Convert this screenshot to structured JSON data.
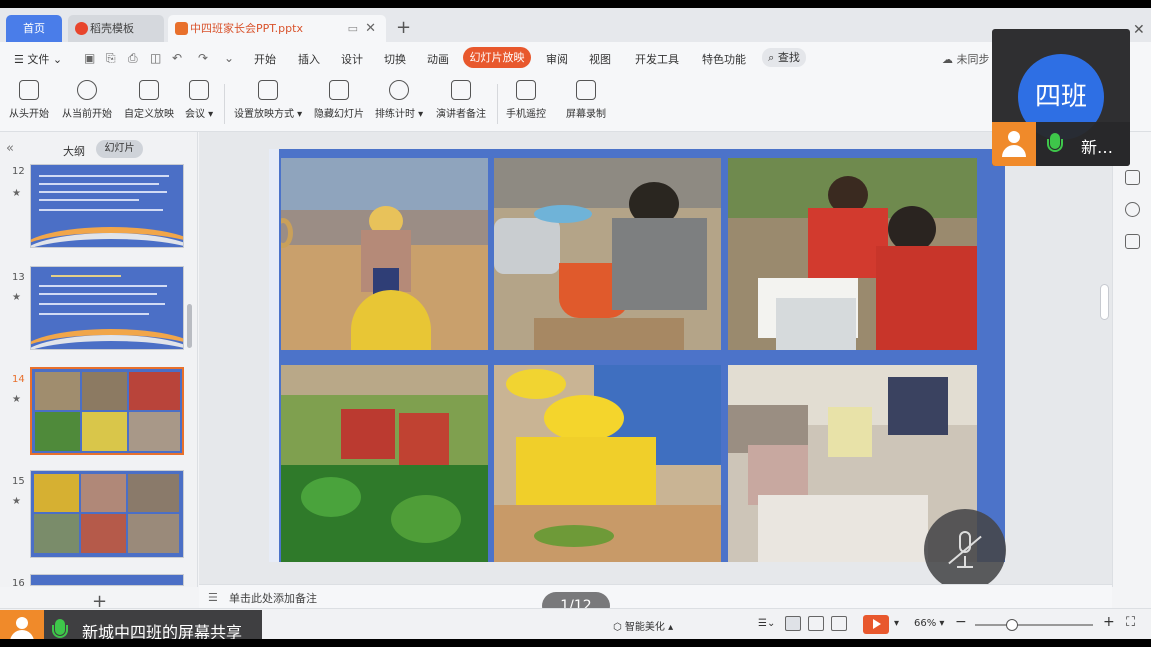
{
  "tabs": {
    "home": "首页",
    "template": "稻壳模板",
    "file": "中四班家长会PPT.pptx"
  },
  "menu": {
    "file": "文件",
    "items": [
      "开始",
      "插入",
      "设计",
      "切换",
      "动画",
      "幻灯片放映",
      "审阅",
      "视图",
      "开发工具",
      "特色功能"
    ],
    "active": "幻灯片放映",
    "search": "查找",
    "sync": "未同步"
  },
  "ribbon": {
    "buttons": [
      "从头开始",
      "从当前开始",
      "自定义放映",
      "会议",
      "设置放映方式",
      "隐藏幻灯片",
      "排练计时",
      "演讲者备注",
      "手机遥控",
      "屏幕录制"
    ]
  },
  "left_panel": {
    "outline_tab": "大纲",
    "slides_tab": "幻灯片",
    "slide_numbers": [
      "12",
      "13",
      "14",
      "15",
      "16"
    ],
    "selected": "14",
    "star": "★"
  },
  "notes": {
    "placeholder": "单击此处添加备注"
  },
  "page_indicator": "1/12",
  "statusbar": {
    "beautify": "智能美化",
    "zoom": "66%"
  },
  "share_banner": {
    "text": "新城中四班的屏幕共享"
  },
  "video_tile": {
    "avatar_text": "四班",
    "name": "新…"
  },
  "colors": {
    "accent": "#e8582d",
    "tab_blue": "#4a7de9",
    "slide_bg": "#4c73c9",
    "avatar_orange": "#f08a2a",
    "avatar_blue": "#2e6fe4",
    "mic_green": "#3ec64a"
  }
}
